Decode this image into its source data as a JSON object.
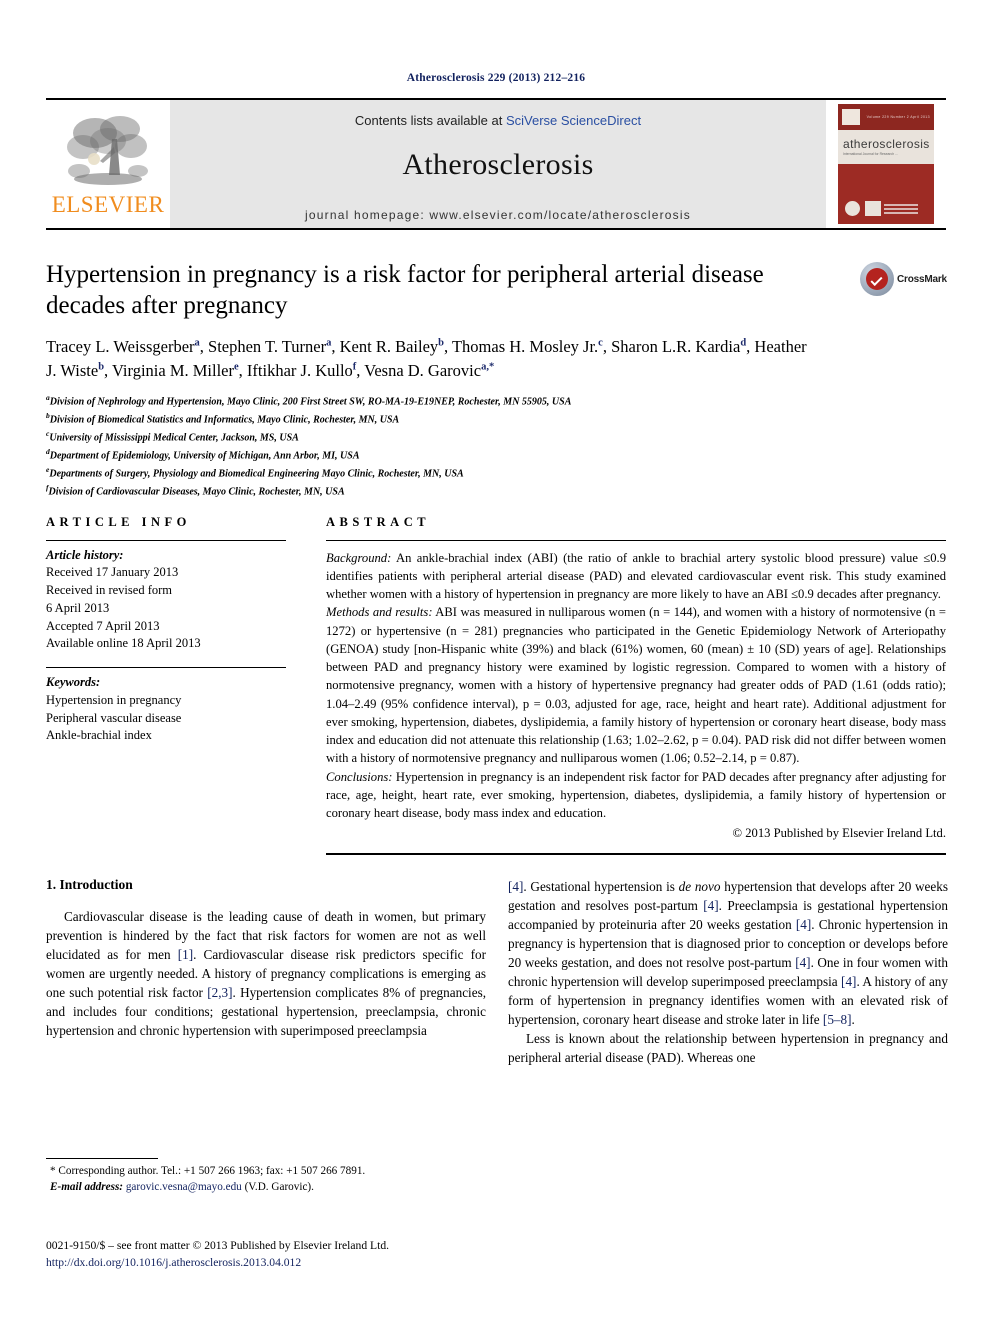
{
  "running_head": "Atherosclerosis 229 (2013) 212–216",
  "banner": {
    "publisher_name": "ELSEVIER",
    "contents_prefix": "Contents lists available at ",
    "contents_link": "SciVerse ScienceDirect",
    "journal_name": "Atherosclerosis",
    "homepage": "journal homepage: www.elsevier.com/locate/atherosclerosis",
    "cover_title": "atherosclerosis",
    "cover_subtitle": "International Journal for Research ...",
    "cover_volume": "Volume 229  Number 2  April 2013"
  },
  "article": {
    "title": "Hypertension in pregnancy is a risk factor for peripheral arterial disease decades after pregnancy",
    "authors": [
      {
        "name": "Tracey L. Weissgerber",
        "sup": "a",
        "sep": ", "
      },
      {
        "name": "Stephen T. Turner",
        "sup": "a",
        "sep": ", "
      },
      {
        "name": "Kent R. Bailey",
        "sup": "b",
        "sep": ", "
      },
      {
        "name": "Thomas H. Mosley Jr.",
        "sup": "c",
        "sep": ", "
      },
      {
        "name": "Sharon L.R. Kardia",
        "sup": "d",
        "sep": ", "
      },
      {
        "name": "Heather J. Wiste",
        "sup": "b",
        "sep": ", "
      },
      {
        "name": "Virginia M. Miller",
        "sup": "e",
        "sep": ", "
      },
      {
        "name": "Iftikhar J. Kullo",
        "sup": "f",
        "sep": ", "
      },
      {
        "name": "Vesna D. Garovic",
        "sup": "a,*",
        "sep": ""
      }
    ],
    "affiliations": [
      {
        "sup": "a",
        "text": "Division of Nephrology and Hypertension, Mayo Clinic, 200 First Street SW, RO-MA-19-E19NEP, Rochester, MN 55905, USA"
      },
      {
        "sup": "b",
        "text": "Division of Biomedical Statistics and Informatics, Mayo Clinic, Rochester, MN, USA"
      },
      {
        "sup": "c",
        "text": "University of Mississippi Medical Center, Jackson, MS, USA"
      },
      {
        "sup": "d",
        "text": "Department of Epidemiology, University of Michigan, Ann Arbor, MI, USA"
      },
      {
        "sup": "e",
        "text": "Departments of Surgery, Physiology and Biomedical Engineering Mayo Clinic, Rochester, MN, USA"
      },
      {
        "sup": "f",
        "text": "Division of Cardiovascular Diseases, Mayo Clinic, Rochester, MN, USA"
      }
    ],
    "crossmark_label": "CrossMark"
  },
  "article_info": {
    "heading": "ARTICLE INFO",
    "history_label": "Article history:",
    "history": [
      "Received 17 January 2013",
      "Received in revised form",
      "6 April 2013",
      "Accepted 7 April 2013",
      "Available online 18 April 2013"
    ],
    "keywords_label": "Keywords:",
    "keywords": [
      "Hypertension in pregnancy",
      "Peripheral vascular disease",
      "Ankle-brachial index"
    ]
  },
  "abstract": {
    "heading": "ABSTRACT",
    "background_label": "Background:",
    "background_text": " An ankle-brachial index (ABI) (the ratio of ankle to brachial artery systolic blood pressure) value ≤0.9 identifies patients with peripheral arterial disease (PAD) and elevated cardiovascular event risk. This study examined whether women with a history of hypertension in pregnancy are more likely to have an ABI ≤0.9 decades after pregnancy.",
    "methods_label": "Methods and results:",
    "methods_text": " ABI was measured in nulliparous women (n = 144), and women with a history of normotensive (n = 1272) or hypertensive (n = 281) pregnancies who participated in the Genetic Epidemiology Network of Arteriopathy (GENOA) study [non-Hispanic white (39%) and black (61%) women, 60 (mean) ± 10 (SD) years of age]. Relationships between PAD and pregnancy history were examined by logistic regression. Compared to women with a history of normotensive pregnancy, women with a history of hypertensive pregnancy had greater odds of PAD (1.61 (odds ratio); 1.04–2.49 (95% confidence interval), p = 0.03, adjusted for age, race, height and heart rate). Additional adjustment for ever smoking, hypertension, diabetes, dyslipidemia, a family history of hypertension or coronary heart disease, body mass index and education did not attenuate this relationship (1.63; 1.02–2.62, p = 0.04). PAD risk did not differ between women with a history of normotensive pregnancy and nulliparous women (1.06; 0.52–2.14, p = 0.87).",
    "conclusions_label": "Conclusions:",
    "conclusions_text": " Hypertension in pregnancy is an independent risk factor for PAD decades after pregnancy after adjusting for race, age, height, heart rate, ever smoking, hypertension, diabetes, dyslipidemia, a family history of hypertension or coronary heart disease, body mass index and education.",
    "copyright": "© 2013 Published by Elsevier Ireland Ltd."
  },
  "introduction": {
    "section_number_title": "1. Introduction",
    "para1_part1": "Cardiovascular disease is the leading cause of death in women, but primary prevention is hindered by the fact that risk factors for women are not as well elucidated as for men ",
    "ref1": "[1]",
    "para1_part2": ". Cardiovascular disease risk predictors specific for women are urgently needed. A history of pregnancy complications is emerging as one such potential risk factor ",
    "ref23": "[2,3]",
    "para1_part3": ". Hypertension complicates 8% of pregnancies, and includes four conditions; gestational hypertension, preeclampsia, chronic hypertension and chronic hypertension with superimposed preeclampsia ",
    "ref4a": "[4]",
    "para1_part4": ". Gestational hypertension is ",
    "denovo": "de novo",
    "para1_part5": " hypertension that develops after 20 weeks gestation and resolves post-partum ",
    "ref4b": "[4]",
    "para1_part6": ". Preeclampsia is gestational hypertension accompanied by proteinuria after 20 weeks gestation ",
    "ref4c": "[4]",
    "para1_part7": ". Chronic hypertension in pregnancy is hypertension that is diagnosed prior to conception or develops before 20 weeks gestation, and does not resolve post-partum ",
    "ref4d": "[4]",
    "para1_part8": ". One in four women with chronic hypertension will develop superimposed preeclampsia ",
    "ref4e": "[4]",
    "para1_part9": ". A history of any form of hypertension in pregnancy identifies women with an elevated risk of hypertension, coronary heart disease and stroke later in life ",
    "ref58": "[5–8]",
    "para1_part10": ".",
    "para2": "Less is known about the relationship between hypertension in pregnancy and peripheral arterial disease (PAD). Whereas one"
  },
  "footnote": {
    "corresponding": "* Corresponding author. Tel.: +1 507 266 1963; fax: +1 507 266 7891.",
    "email_label": "E-mail address:",
    "email": "garovic.vesna@mayo.edu",
    "email_suffix": " (V.D. Garovic)."
  },
  "colophon": {
    "issn_line": "0021-9150/$ – see front matter © 2013 Published by Elsevier Ireland Ltd.",
    "doi": "http://dx.doi.org/10.1016/j.atherosclerosis.2013.04.012"
  }
}
